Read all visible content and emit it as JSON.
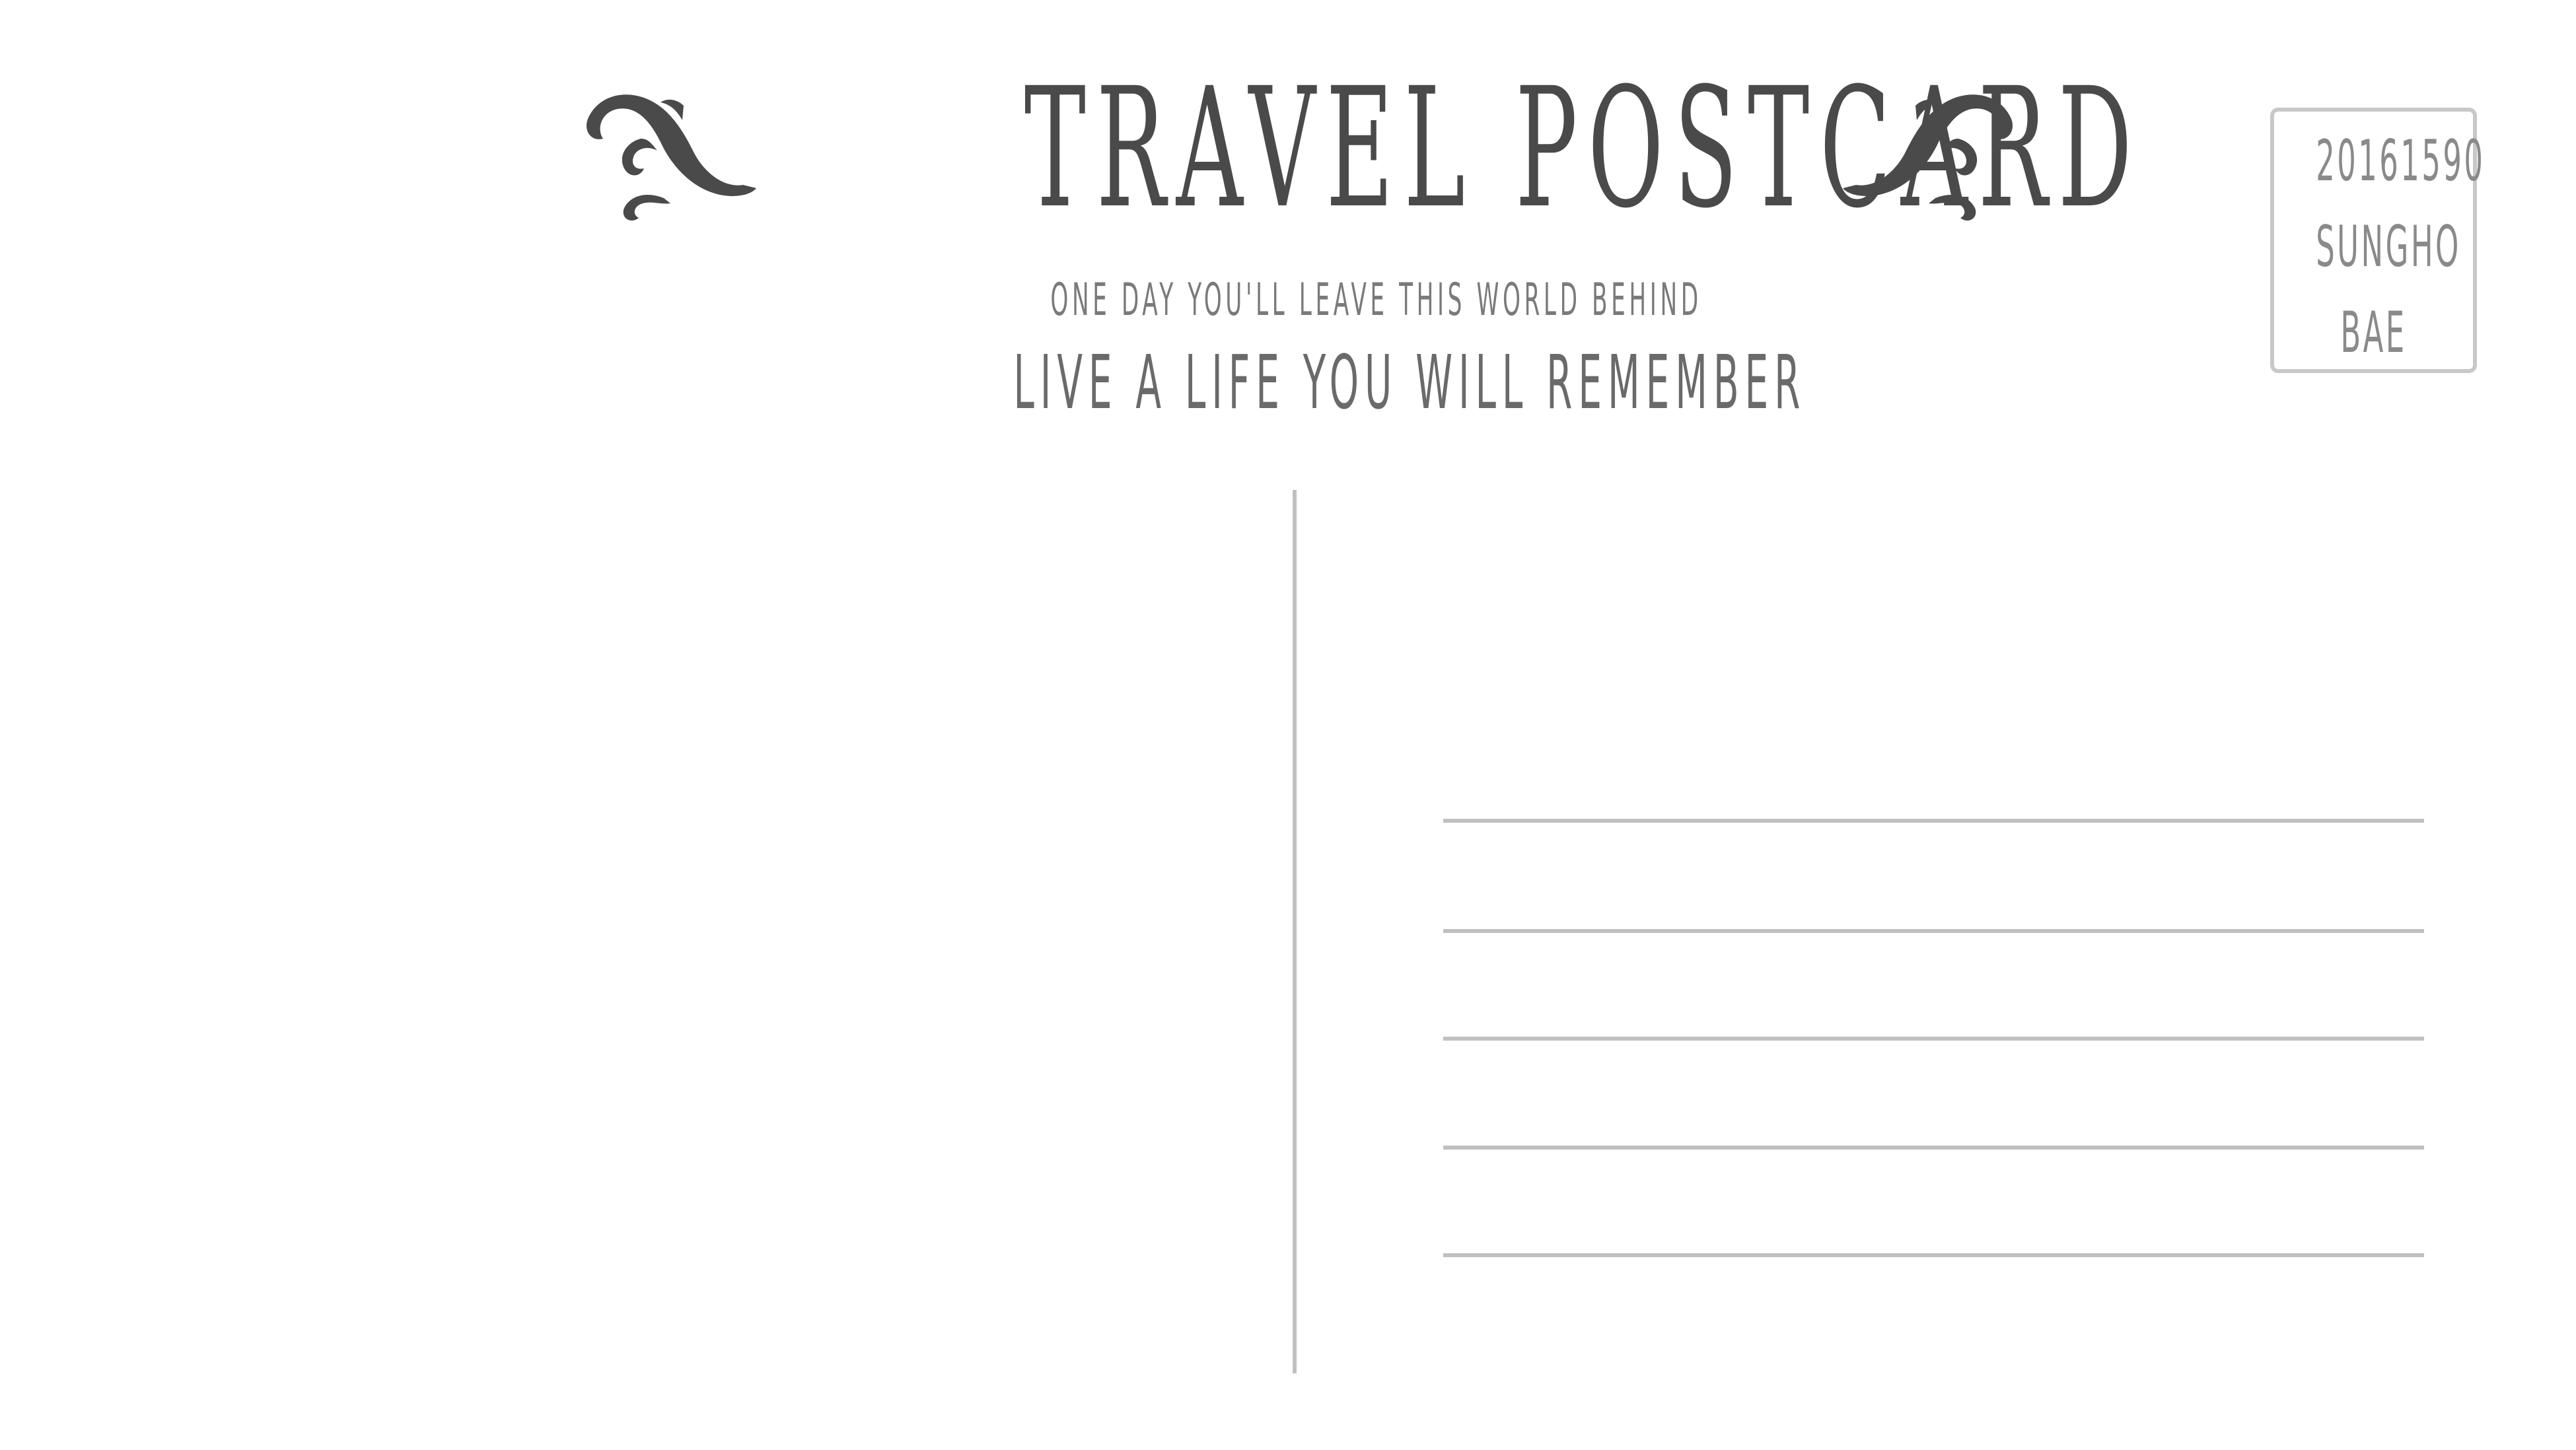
{
  "postcard": {
    "title": "TRAVEL POSTCARD",
    "tagline_small": "ONE DAY YOU'LL LEAVE THIS WORLD BEHIND",
    "tagline_large": "LIVE A LIFE YOU WILL REMEMBER",
    "ornament_icon": "flourish-ornament-icon"
  },
  "stamp": {
    "line1": "20161590",
    "line2": "SUNGHO",
    "line3": "BAE"
  },
  "colors": {
    "ink": "#4a4a4a",
    "text_light": "#7a7a7a",
    "rule": "#c0c0c0",
    "background": "#ffffff"
  }
}
